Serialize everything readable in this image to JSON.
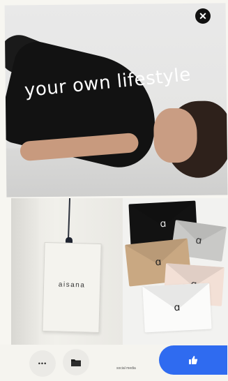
{
  "hero": {
    "headline": "your own lifestyle"
  },
  "close_button": {
    "icon": "close-icon",
    "glyph": "✕"
  },
  "tag_tile": {
    "brand": "aisana",
    "fine_print_1": "",
    "fine_print_2": ""
  },
  "envelope_tile": {
    "logo": "ɑ"
  },
  "toolbar": {
    "more_glyph": "•••",
    "more_icon": "more-icon",
    "folder_icon": "folder-icon",
    "social_label": "social media",
    "like_icon": "thumbs-up-icon"
  },
  "colors": {
    "accent": "#2f6bf0",
    "background": "#f5f4ef"
  }
}
